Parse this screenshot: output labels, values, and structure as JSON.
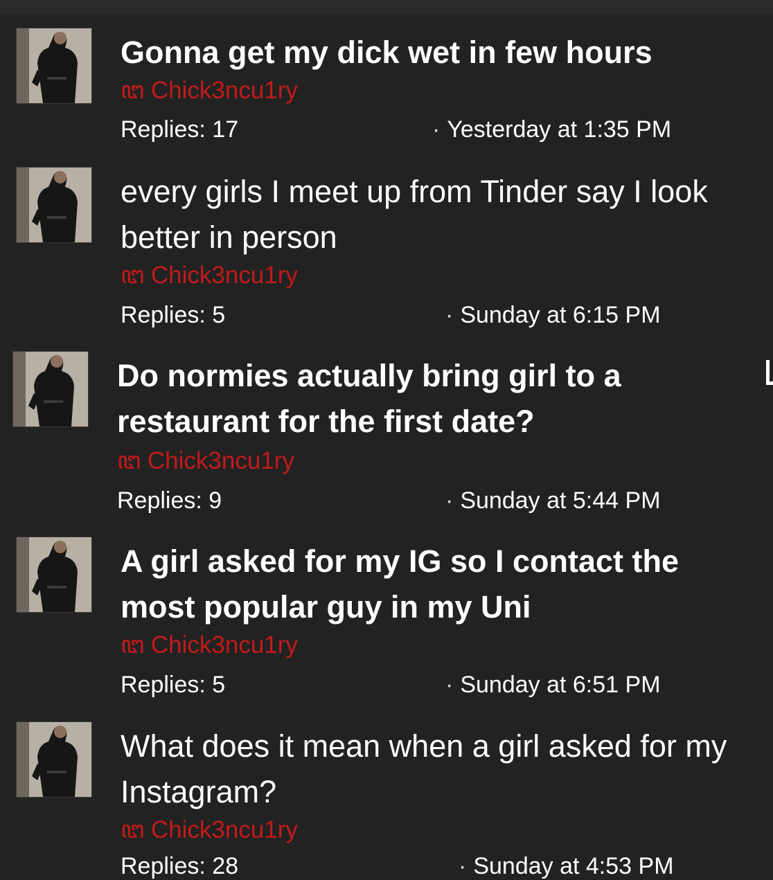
{
  "threads": [
    {
      "title": "Gonna get my dick wet in few hours",
      "author": "ꦔ Chick3ncu1ry",
      "replies": "Replies: 17",
      "date": "Yesterday at 1:35 PM"
    },
    {
      "title_line1": "every girls I meet up from Tinder say I look",
      "title_line2": "better in person",
      "author": "ꦔ Chick3ncu1ry",
      "replies": "Replies: 5",
      "date": "Sunday at 6:15 PM"
    },
    {
      "title_line1": "Do normies actually bring girl to a",
      "title_line2": "restaurant for the first date?",
      "author": "ꦔ Chick3ncu1ry",
      "replies": "Replies: 9",
      "date": "Sunday at 5:44 PM"
    },
    {
      "title_line1": "A girl asked for my IG so I contact the",
      "title_line2": "most popular guy in my Uni",
      "author": "ꦔ Chick3ncu1ry",
      "replies": "Replies: 5",
      "date": "Sunday at 6:51 PM"
    },
    {
      "title_line1": "What does it mean when a girl asked for my",
      "title_line2": "Instagram?",
      "author": "ꦔ Chick3ncu1ry",
      "replies": "Replies: 28",
      "date": "Sunday at 4:53 PM"
    }
  ],
  "date_separator": "·",
  "colors": {
    "background": "#222222",
    "author": "#c21a1a",
    "text": "#ffffff"
  },
  "icons": {
    "avatar": "user-avatar-photo"
  }
}
